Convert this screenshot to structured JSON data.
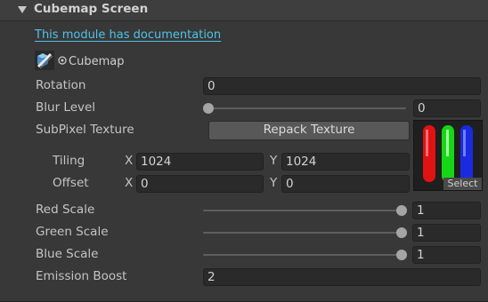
{
  "header": {
    "title": "Cubemap Screen"
  },
  "doc_link": "This module has documentation",
  "texture_slot": {
    "label": "Cubemap"
  },
  "fields": {
    "rotation": {
      "label": "Rotation",
      "value": "0"
    },
    "blur_level": {
      "label": "Blur Level",
      "value": "0",
      "slider_fraction": 0
    },
    "subpixel": {
      "label": "SubPixel Texture",
      "button": "Repack Texture",
      "select_label": "Select"
    },
    "tiling": {
      "label": "Tiling",
      "x_label": "X",
      "x": "1024",
      "y_label": "Y",
      "y": "1024"
    },
    "offset": {
      "label": "Offset",
      "x_label": "X",
      "x": "0",
      "y_label": "Y",
      "y": "0"
    },
    "red_scale": {
      "label": "Red Scale",
      "value": "1",
      "slider_fraction": 1
    },
    "green_scale": {
      "label": "Green Scale",
      "value": "1",
      "slider_fraction": 1
    },
    "blue_scale": {
      "label": "Blue Scale",
      "value": "1",
      "slider_fraction": 1
    },
    "emission_boost": {
      "label": "Emission Boost",
      "value": "2"
    }
  },
  "colors": {
    "link": "#4fc3e8",
    "subpixel_red": "#e01212",
    "subpixel_green": "#16d616",
    "subpixel_blue": "#1a2ae0"
  },
  "icons": [
    "foldout-arrow-icon",
    "cubemap-icon",
    "pick-object-icon"
  ]
}
